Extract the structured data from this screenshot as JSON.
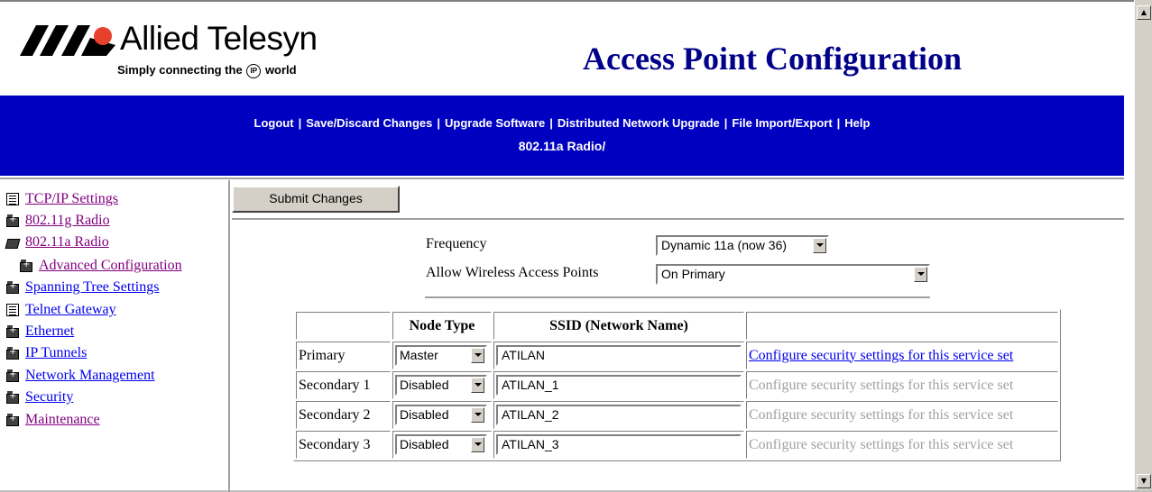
{
  "header": {
    "logo_name": "Allied Telesyn",
    "logo_tagline_pre": "Simply connecting the",
    "logo_tagline_ip": "IP",
    "logo_tagline_post": "world",
    "title": "Access Point Configuration"
  },
  "nav": {
    "links": [
      "Logout",
      "Save/Discard Changes",
      "Upgrade Software",
      "Distributed Network Upgrade",
      "File Import/Export",
      "Help"
    ]
  },
  "breadcrumb": "802.11a Radio/",
  "sidebar": {
    "items": [
      {
        "label": "TCP/IP Settings",
        "icon": "document-icon"
      },
      {
        "label": "802.11g Radio",
        "icon": "folder-closed-icon"
      },
      {
        "label": "802.11a Radio",
        "icon": "folder-open-icon"
      },
      {
        "label": "Advanced Configuration",
        "icon": "folder-closed-icon"
      },
      {
        "label": "Spanning Tree Settings",
        "icon": "folder-closed-icon"
      },
      {
        "label": "Telnet Gateway",
        "icon": "document-icon"
      },
      {
        "label": "Ethernet",
        "icon": "folder-closed-icon"
      },
      {
        "label": "IP Tunnels",
        "icon": "folder-closed-icon"
      },
      {
        "label": "Network Management",
        "icon": "folder-closed-icon"
      },
      {
        "label": "Security",
        "icon": "folder-closed-icon"
      },
      {
        "label": "Maintenance",
        "icon": "folder-closed-icon"
      }
    ]
  },
  "form": {
    "submit_label": "Submit Changes",
    "frequency_label": "Frequency",
    "frequency_value": "Dynamic 11a (now 36)",
    "allow_label": "Allow Wireless Access Points",
    "allow_value": "On Primary"
  },
  "table": {
    "headers": [
      "",
      "Node Type",
      "SSID (Network Name)",
      ""
    ],
    "rows": [
      {
        "name": "Primary",
        "node_type": "Master",
        "ssid": "ATILAN",
        "link": "Configure security settings for this service set",
        "enabled": true
      },
      {
        "name": "Secondary 1",
        "node_type": "Disabled",
        "ssid": "ATILAN_1",
        "link": "Configure security settings for this service set",
        "enabled": false
      },
      {
        "name": "Secondary 2",
        "node_type": "Disabled",
        "ssid": "ATILAN_2",
        "link": "Configure security settings for this service set",
        "enabled": false
      },
      {
        "name": "Secondary 3",
        "node_type": "Disabled",
        "ssid": "ATILAN_3",
        "link": "Configure security settings for this service set",
        "enabled": false
      }
    ]
  },
  "colors": {
    "nav_bar": "#0000c0",
    "title": "#00008b",
    "visited_link": "#800080",
    "link": "#0000ee",
    "logo_red": "#e8402a"
  }
}
